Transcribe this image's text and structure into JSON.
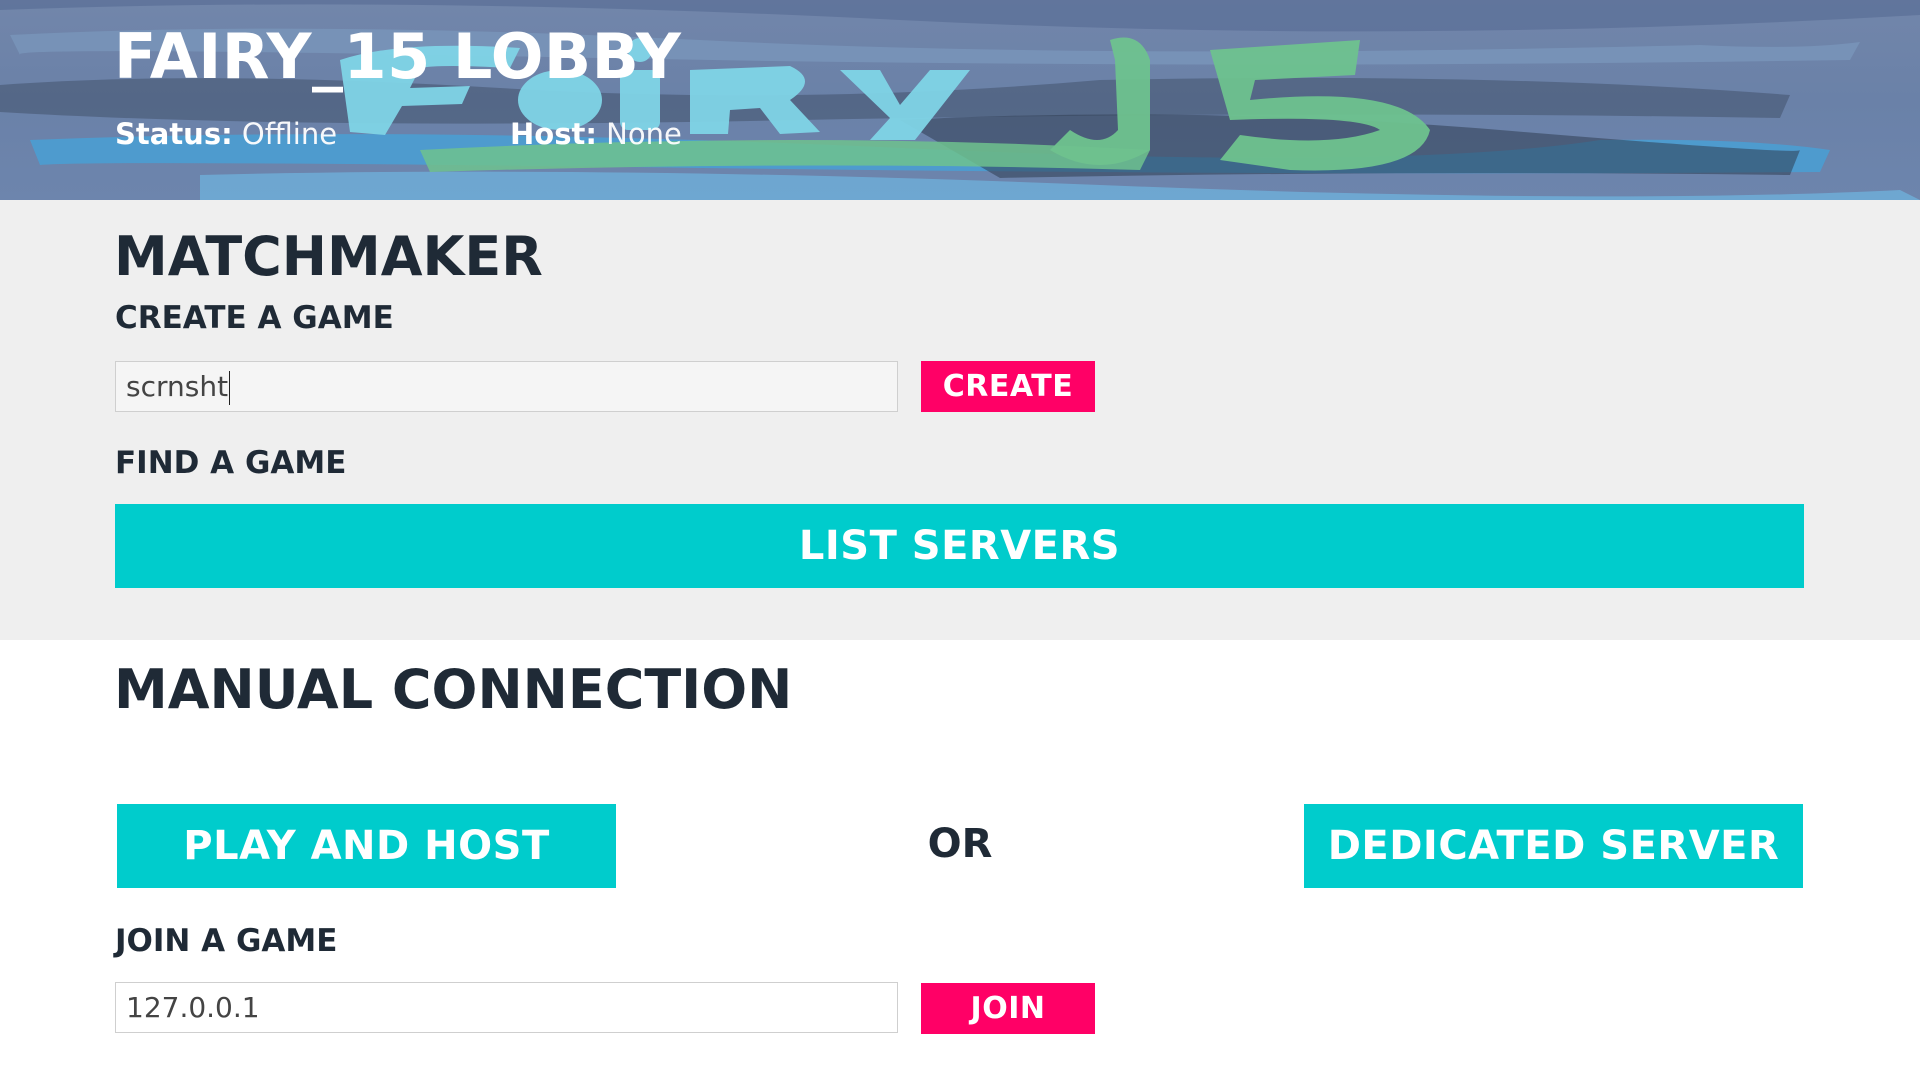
{
  "header": {
    "title": "FAIRY_15 LOBBY",
    "banner_logo_text": "Fairy15",
    "status_label": "Status:",
    "status_value": "Offline",
    "host_label": "Host:",
    "host_value": "None"
  },
  "matchmaker": {
    "heading": "MATCHMAKER",
    "create_heading": "CREATE A GAME",
    "create_input_value": "scrnsht",
    "create_button": "CREATE",
    "find_heading": "FIND A GAME",
    "list_servers_button": "LIST SERVERS"
  },
  "manual": {
    "heading": "MANUAL CONNECTION",
    "play_host_button": "PLAY AND HOST",
    "or_label": "OR",
    "dedicated_button": "DEDICATED SERVER",
    "join_heading": "JOIN A GAME",
    "join_input_value": "127.0.0.1",
    "join_button": "JOIN"
  },
  "colors": {
    "accent_pink": "#ff0066",
    "accent_teal": "#00cccc",
    "heading_text": "#1f2a36",
    "matchmaker_bg": "#efefef"
  }
}
